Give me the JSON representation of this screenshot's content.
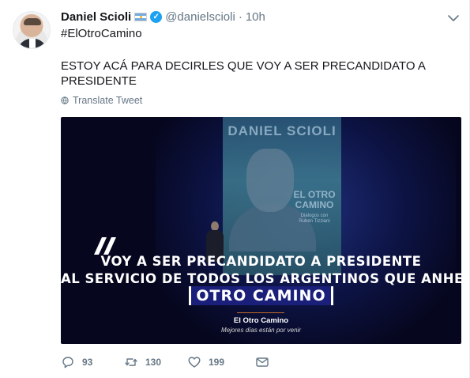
{
  "tweet": {
    "author_name": "Daniel Scioli",
    "handle": "@danielscioli",
    "separator": "·",
    "time": "10h",
    "hashtag": "#ElOtroCamino",
    "text": "ESTOY ACÁ PARA DECIRLES QUE VOY A SER PRECANDIDATO A PRESIDENTE",
    "translate_label": "Translate Tweet",
    "icons": {
      "avatar": "avatar",
      "flag": "argentina-flag-icon",
      "verified": "verified-badge-icon",
      "caret": "chevron-down-icon",
      "translate": "globe-icon"
    }
  },
  "media": {
    "banner_title": "DANIEL SCIOLI",
    "banner_subtitle_1": "EL OTRO",
    "banner_subtitle_2": "CAMINO",
    "banner_small_1": "Diálogos con",
    "banner_small_2": "Rubén Tizziani",
    "quote_symbol": "quote-mark-icon",
    "caption_line1": "VOY A SER PRECANDIDATO A PRESIDENTE",
    "caption_line2": "AL SERVICIO DE TODOS LOS ARGENTINOS QUE ANHELAN",
    "caption_highlight": "OTRO CAMINO",
    "sign_title": "El Otro Camino",
    "sign_subtitle": "Mejores días están por venir",
    "colors": {
      "background": "#06071f",
      "highlight": "#1a1f7a",
      "rule": "#c46a2a"
    }
  },
  "actions": {
    "reply_count": "93",
    "retweet_count": "130",
    "like_count": "199",
    "icons": [
      "reply-icon",
      "retweet-icon",
      "like-icon",
      "message-icon"
    ]
  },
  "colors": {
    "accent": "#1da1f2",
    "muted": "#657786",
    "text": "#14171a"
  }
}
